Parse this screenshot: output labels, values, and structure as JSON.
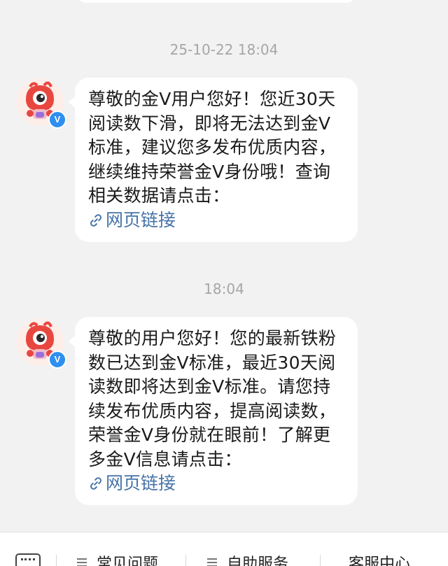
{
  "messages": [
    {
      "timestamp": "25-10-22 18:04",
      "text": "尊敬的金V用户您好！您近30天阅读数下滑，即将无法达到金V标准，建议您多发布优质内容，继续维持荣誉金V身份哦！查询相关数据请点击：",
      "link_label": "网页链接"
    },
    {
      "timestamp": "18:04",
      "text": "尊敬的用户您好！您的最新铁粉数已达到金V标准，最近30天阅读数即将达到金V标准。请您持续发布优质内容，提高阅读数，荣誉金V身份就在眼前！了解更多金V信息请点击：",
      "link_label": "网页链接"
    }
  ],
  "avatar": {
    "badge": "V",
    "badge_color": "#2e8ff0",
    "mascot_color": "#e8473f"
  },
  "toolbar": {
    "items": [
      {
        "label": "常见问题",
        "icon": "menu-icon"
      },
      {
        "label": "自助服务",
        "icon": "menu-icon"
      },
      {
        "label": "客服中心",
        "icon": ""
      }
    ]
  },
  "colors": {
    "background": "#f2f2f2",
    "bubble": "#ffffff",
    "link": "#4673a8",
    "timestamp": "#a6a6a6"
  }
}
